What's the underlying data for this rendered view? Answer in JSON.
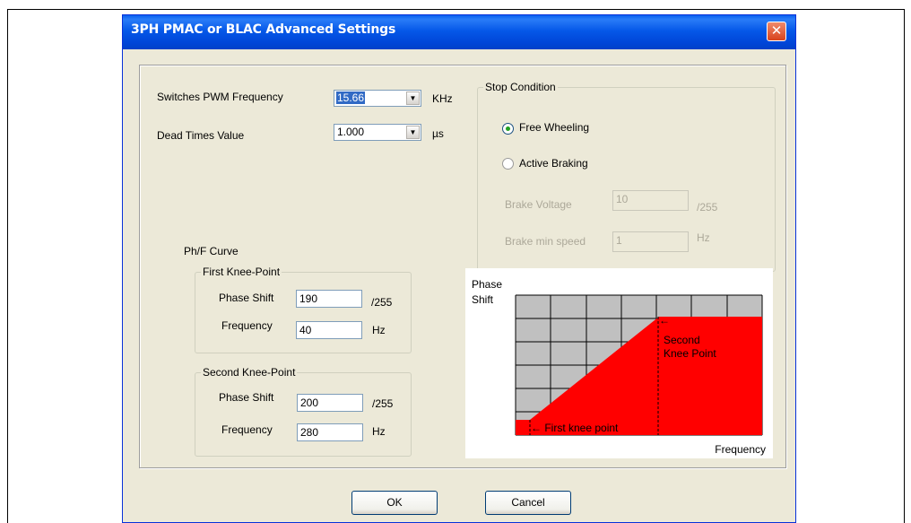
{
  "window": {
    "title": "3PH PMAC or BLAC Advanced Settings",
    "close_glyph": "✕"
  },
  "pwm": {
    "label": "Switches PWM Frequency",
    "value": "15.66",
    "unit": "KHz"
  },
  "dead_times": {
    "label": "Dead Times Value",
    "value": "1.000",
    "unit": "µs"
  },
  "stop_condition": {
    "title": "Stop Condition",
    "free_wheeling": "Free Wheeling",
    "active_braking": "Active Braking",
    "selected": "free_wheeling",
    "brake_voltage": {
      "label": "Brake Voltage",
      "value": "10",
      "unit": "/255"
    },
    "brake_min_speed": {
      "label": "Brake min speed",
      "value": "1",
      "unit": "Hz"
    }
  },
  "curve": {
    "title": "Ph/F Curve",
    "first": {
      "title": "First Knee-Point",
      "phase_label": "Phase Shift",
      "phase_value": "190",
      "phase_unit": "/255",
      "freq_label": "Frequency",
      "freq_value": "40",
      "freq_unit": "Hz"
    },
    "second": {
      "title": "Second Knee-Point",
      "phase_label": "Phase Shift",
      "phase_value": "200",
      "phase_unit": "/255",
      "freq_label": "Frequency",
      "freq_value": "280",
      "freq_unit": "Hz"
    }
  },
  "diagram": {
    "y_label_line1": "Phase",
    "y_label_line2": "Shift",
    "x_label": "Frequency",
    "first_knee_label": "← First knee point",
    "second_knee_line1": "Second",
    "second_knee_line2": "Knee Point",
    "fill_color": "#ff0000",
    "grid_color": "#c0c0c0"
  },
  "buttons": {
    "ok": "OK",
    "cancel": "Cancel"
  }
}
